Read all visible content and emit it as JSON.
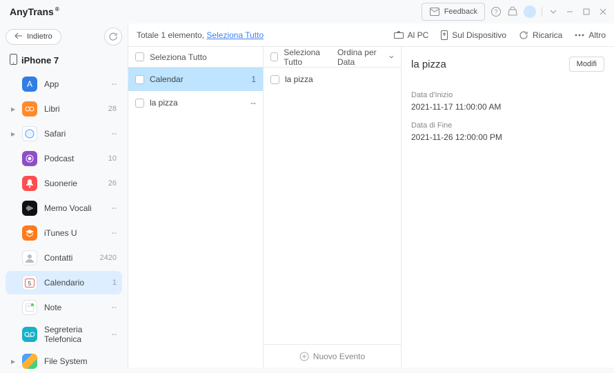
{
  "titlebar": {
    "brand": "AnyTrans",
    "reg_mark": "®",
    "feedback": "Feedback"
  },
  "sidebar": {
    "back": "Indietro",
    "device": "iPhone 7",
    "items": [
      {
        "label": "App",
        "count": "--",
        "expandable": false
      },
      {
        "label": "Libri",
        "count": "28",
        "expandable": true
      },
      {
        "label": "Safari",
        "count": "--",
        "expandable": true
      },
      {
        "label": "Podcast",
        "count": "10",
        "expandable": false
      },
      {
        "label": "Suonerie",
        "count": "26",
        "expandable": false
      },
      {
        "label": "Memo Vocali",
        "count": "--",
        "expandable": false
      },
      {
        "label": "iTunes U",
        "count": "--",
        "expandable": false
      },
      {
        "label": "Contatti",
        "count": "2420",
        "expandable": false
      },
      {
        "label": "Calendario",
        "count": "1",
        "expandable": false
      },
      {
        "label": "Note",
        "count": "--",
        "expandable": false
      },
      {
        "label": "Segreteria Telefonica",
        "count": "--",
        "expandable": false
      },
      {
        "label": "File System",
        "count": "",
        "expandable": true
      }
    ],
    "selected_index": 8
  },
  "toolbar": {
    "summary_prefix": "Totale 1 elemento, ",
    "select_all_link": "Seleziona Tutto",
    "to_pc": "Al PC",
    "on_device": "Sul Dispositivo",
    "refresh": "Ricarica",
    "more": "Altro"
  },
  "col1": {
    "header": "Seleziona Tutto",
    "rows": [
      {
        "label": "Calendar",
        "count": "1",
        "selected": true
      },
      {
        "label": "la pizza",
        "count": "--",
        "selected": false
      }
    ]
  },
  "col2": {
    "header": "Seleziona Tutto",
    "sort": "Ordina per Data",
    "rows": [
      {
        "label": "la pizza"
      }
    ],
    "new_event": "Nuovo Evento"
  },
  "detail": {
    "title": "la pizza",
    "modify": "Modifi",
    "start_label": "Data d'Inizio",
    "start_value": "2021-11-17 11:00:00 AM",
    "end_label": "Data di Fine",
    "end_value": "2021-11-26 12:00:00 PM"
  }
}
